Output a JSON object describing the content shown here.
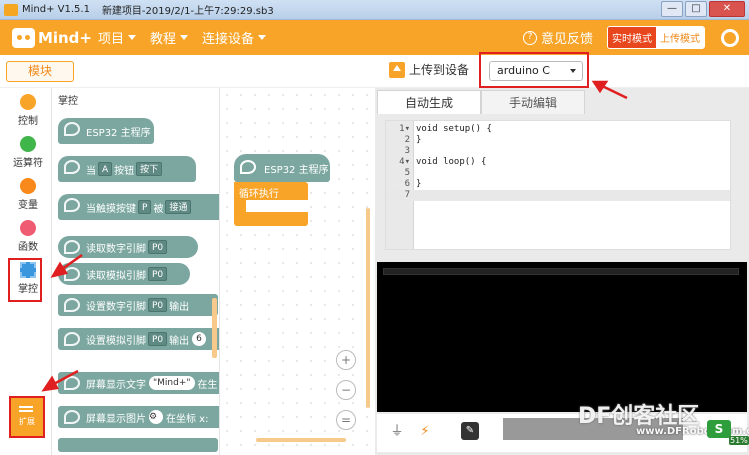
{
  "window": {
    "app_name": "Mind+ V1.5.1",
    "file_title": "新建项目-2019/2/1-上午7:29:29.sb3",
    "minimize": "—",
    "maximize": "□",
    "close": "✕"
  },
  "header": {
    "logo_text": "Mind+",
    "menu": [
      {
        "label": "项目"
      },
      {
        "label": "教程"
      },
      {
        "label": "连接设备"
      }
    ],
    "feedback_label": "意见反馈",
    "mode_realtime": "实时模式",
    "mode_upload": "上传模式",
    "icons": {
      "feedback": "help-circle-icon",
      "settings": "gear-icon"
    }
  },
  "toolbar": {
    "module_tab": "模块",
    "upload_label": "上传到设备",
    "device_selected": "arduino C"
  },
  "categories": [
    {
      "label": "控制",
      "color": "#f8a428"
    },
    {
      "label": "运算符",
      "color": "#3fb54a"
    },
    {
      "label": "变量",
      "color": "#f8891a"
    },
    {
      "label": "函数",
      "color": "#ef5b73"
    },
    {
      "label": "掌控",
      "color": "#3a96dd"
    }
  ],
  "extension": {
    "label": "扩展"
  },
  "palette": {
    "title": "掌控",
    "blocks": {
      "main_program": "ESP32 主程序",
      "when_button": {
        "prefix": "当",
        "button": "A",
        "button_text": "按钮",
        "action": "按下"
      },
      "touch_button": {
        "prefix": "当触摸按键",
        "key": "P",
        "mid": "被",
        "action": "接通"
      },
      "read_digital": {
        "prefix": "读取数字引脚",
        "pin": "P0"
      },
      "read_analog": {
        "prefix": "读取模拟引脚",
        "pin": "P0"
      },
      "set_digital": {
        "prefix": "设置数字引脚",
        "pin": "P0",
        "suffix": "输出"
      },
      "set_analog": {
        "prefix": "设置模拟引脚",
        "pin": "P0",
        "suffix": "输出",
        "value": "6"
      },
      "screen_text": {
        "prefix": "屏幕显示文字",
        "text": "\"Mind+\"",
        "suffix": "在生"
      },
      "screen_image": {
        "prefix": "屏幕显示图片",
        "suffix": "在坐标 x:"
      }
    }
  },
  "workspace": {
    "hat_label": "ESP32 主程序",
    "loop_label": "循环执行",
    "zoom_in": "+",
    "zoom_out": "−",
    "zoom_reset": "="
  },
  "code_panel": {
    "tabs": [
      "自动生成",
      "手动编辑"
    ],
    "lines": [
      {
        "n": "1",
        "fold": "▾",
        "code": "void setup() {"
      },
      {
        "n": "2",
        "fold": "",
        "code": "}"
      },
      {
        "n": "3",
        "fold": "",
        "code": ""
      },
      {
        "n": "4",
        "fold": "▾",
        "code": "void loop() {"
      },
      {
        "n": "5",
        "fold": "",
        "code": ""
      },
      {
        "n": "6",
        "fold": "",
        "code": "}"
      },
      {
        "n": "7",
        "fold": "",
        "code": ""
      }
    ]
  },
  "console_tools": {
    "usb": "⏚",
    "clear": "⚡",
    "erase": "✎"
  },
  "watermark": {
    "text": "DF创客社区",
    "url": "www.DFRobot.com.cn"
  },
  "tray": {
    "s_icon": "S",
    "pct": "51%"
  }
}
